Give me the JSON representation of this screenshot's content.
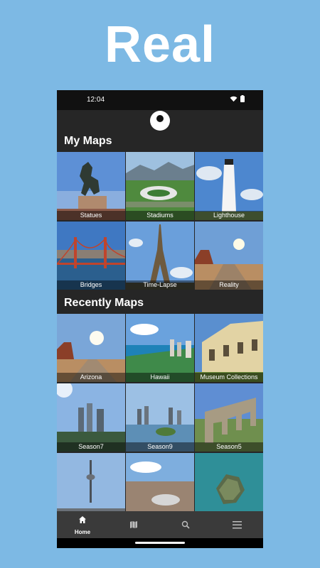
{
  "promo": {
    "headline": "Real"
  },
  "status_bar": {
    "time": "12:04"
  },
  "my_maps": {
    "title": "My Maps",
    "tiles": [
      {
        "label": "Statues"
      },
      {
        "label": "Stadiums"
      },
      {
        "label": "Lighthouse"
      },
      {
        "label": "Bridges"
      },
      {
        "label": "Time-Lapse"
      },
      {
        "label": "Reality"
      }
    ]
  },
  "recent_maps": {
    "title": "Recently Maps",
    "tiles": [
      {
        "label": "Arizona"
      },
      {
        "label": "Hawaii"
      },
      {
        "label": "Museum Collections"
      },
      {
        "label": "Season7"
      },
      {
        "label": "Season9"
      },
      {
        "label": "Season5"
      },
      {
        "label": ""
      },
      {
        "label": ""
      },
      {
        "label": ""
      }
    ]
  },
  "bottom_nav": {
    "items": [
      {
        "label": "Home",
        "icon": "home-icon",
        "active": true
      },
      {
        "label": "",
        "icon": "map-icon"
      },
      {
        "label": "",
        "icon": "search-icon"
      },
      {
        "label": "",
        "icon": "menu-icon"
      }
    ]
  },
  "colors": {
    "background": "#7db9e4",
    "app_dark": "#262626",
    "nav": "#3a3a3a"
  }
}
